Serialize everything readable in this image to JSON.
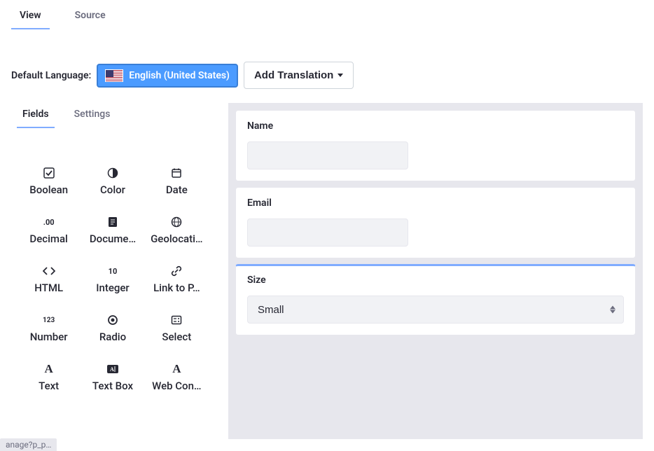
{
  "top_tabs": {
    "view": "View",
    "source": "Source"
  },
  "language": {
    "label": "Default Language:",
    "selected": "English (United States)",
    "add_translation": "Add Translation"
  },
  "sub_tabs": {
    "fields": "Fields",
    "settings": "Settings"
  },
  "field_types": {
    "boolean": "Boolean",
    "color": "Color",
    "date": "Date",
    "decimal": "Decimal",
    "document": "Docume…",
    "geolocation": "Geolocati…",
    "html": "HTML",
    "integer": "Integer",
    "link_to_page": "Link to P…",
    "number": "Number",
    "radio": "Radio",
    "select": "Select",
    "text": "Text",
    "text_box": "Text Box",
    "web_content": "Web Con…"
  },
  "form": {
    "name": {
      "label": "Name",
      "value": ""
    },
    "email": {
      "label": "Email",
      "value": ""
    },
    "size": {
      "label": "Size",
      "value": "Small"
    }
  },
  "bottom_stub": "anage?p_p…"
}
